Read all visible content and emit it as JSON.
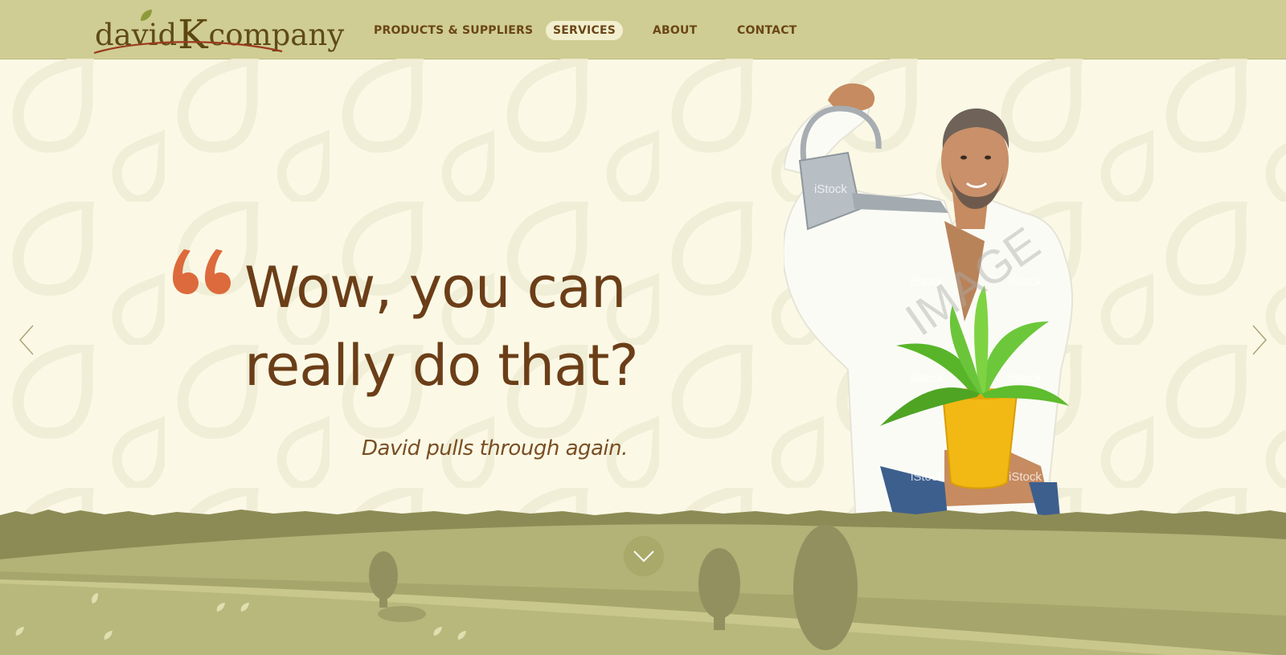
{
  "logo": {
    "part1": "david",
    "part2": "K",
    "part3": "company"
  },
  "nav": {
    "items": [
      {
        "label": "PRODUCTS & SUPPLIERS",
        "active": false
      },
      {
        "label": "SERVICES",
        "active": true
      },
      {
        "label": "ABOUT",
        "active": false
      },
      {
        "label": "CONTACT",
        "active": false
      }
    ]
  },
  "hero": {
    "quote_line1": "Wow, you can",
    "quote_line2": "really do that?",
    "subquote": "David pulls through again.",
    "image_watermark": "IMAGE",
    "stock_label": "iStock"
  },
  "icons": {
    "prev": "chevron-left-icon",
    "next": "chevron-right-icon",
    "scroll": "chevron-down-icon",
    "quote": "open-quote-icon"
  },
  "colors": {
    "header_bg": "#cfcd93",
    "page_bg": "#fbf9e6",
    "nav_text": "#6a4616",
    "quote_text": "#6b3e18",
    "quote_mark": "#dd6a3c",
    "grass_dark": "#8d8b55",
    "grass_light": "#b9b87c"
  }
}
